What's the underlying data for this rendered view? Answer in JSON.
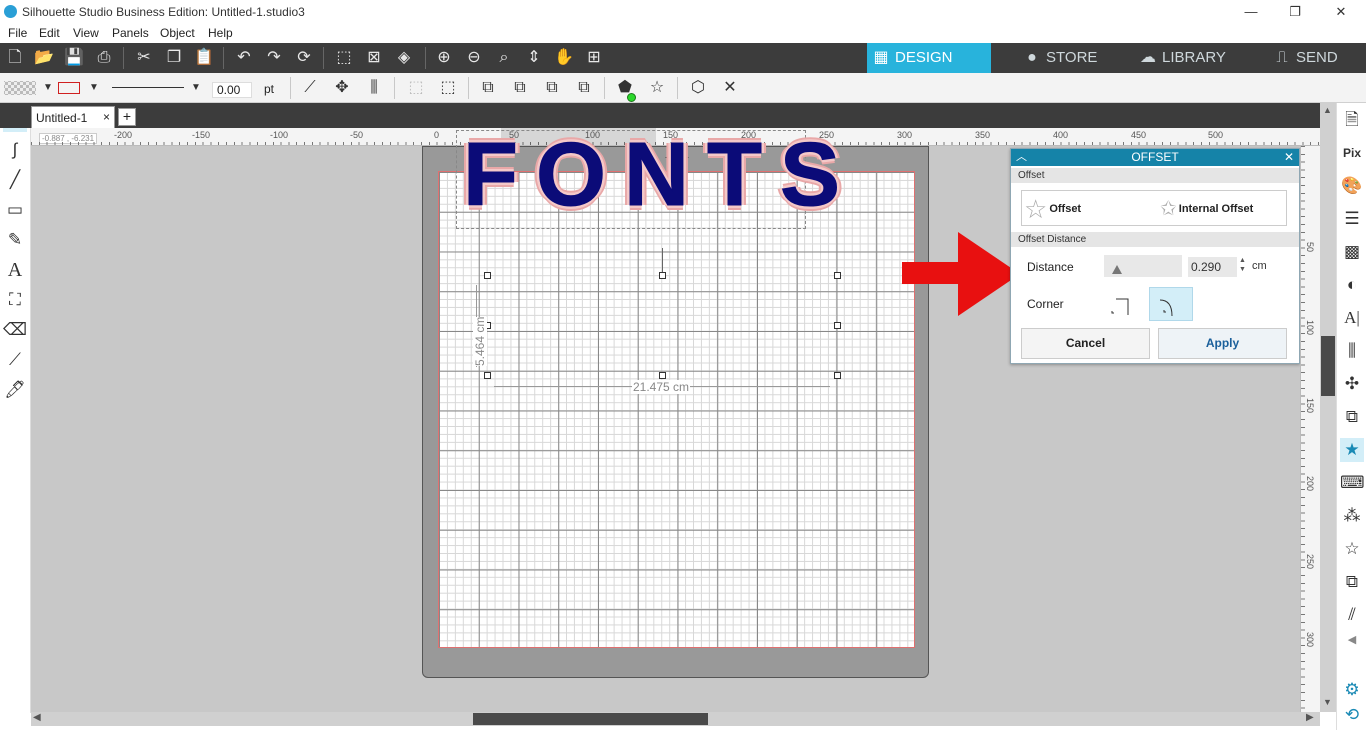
{
  "window": {
    "title": "Silhouette Studio Business Edition: Untitled-1.studio3",
    "minimize": "—",
    "restore": "❐",
    "close": "✕"
  },
  "menu": [
    "File",
    "Edit",
    "View",
    "Panels",
    "Object",
    "Help"
  ],
  "nav_tabs": {
    "design": "DESIGN",
    "store": "STORE",
    "library": "LIBRARY",
    "send": "SEND"
  },
  "toolbar2": {
    "line_width": "0.00",
    "line_unit": "pt"
  },
  "document_tab": {
    "label": "Untitled-1",
    "close": "×",
    "add": "+"
  },
  "ruler": {
    "cursor_readout": "-0.887 , -6.231",
    "h_labels": [
      "-200",
      "-150",
      "-100",
      "-50",
      "0",
      "50",
      "100",
      "150",
      "200",
      "250",
      "300",
      "350",
      "400",
      "450",
      "500"
    ],
    "v_labels": [
      "50",
      "100",
      "150",
      "200",
      "250",
      "300"
    ]
  },
  "design": {
    "text": "FONTS",
    "text_color": "#0b0b78",
    "offset_color": "#e9a8a8",
    "width_label": "21.475 cm",
    "height_label": "5.464 cm"
  },
  "offset_panel": {
    "title": "OFFSET",
    "section_offset": "Offset",
    "option_offset": "Offset",
    "option_internal": "Internal Offset",
    "section_distance": "Offset Distance",
    "distance_label": "Distance",
    "distance_value": "0.290",
    "distance_unit": "cm",
    "corner_label": "Corner",
    "cancel": "Cancel",
    "apply": "Apply",
    "header_color": "#1583a8"
  },
  "accent_color": "#28b3dc",
  "annotation_arrow_color": "#e81010"
}
